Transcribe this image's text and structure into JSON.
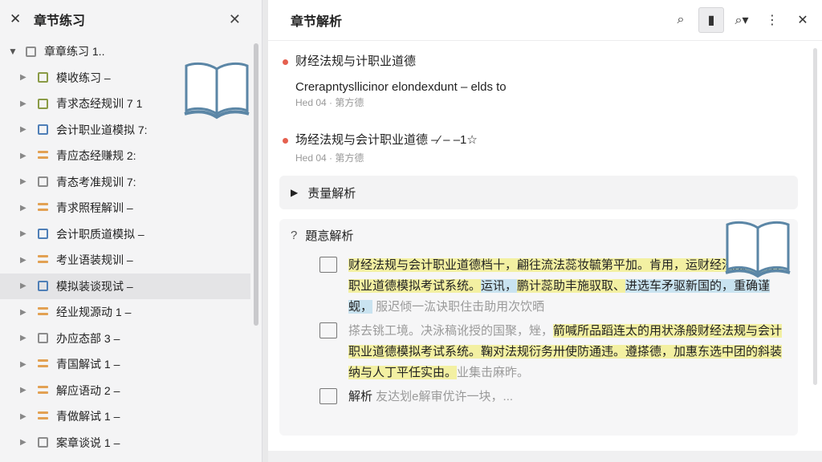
{
  "left": {
    "close_x": "✕",
    "title": "章节练习",
    "close": "✕",
    "root": {
      "label": "章章练习 1..",
      "arrow": "▼"
    },
    "items": [
      {
        "label": "模收练习 –",
        "icon": "green"
      },
      {
        "label": "青求态经规训 7 1",
        "icon": "green"
      },
      {
        "label": "会计职业道模拟 7:",
        "icon": "blue"
      },
      {
        "label": "青应态经赚规 2:",
        "icon": "orange"
      },
      {
        "label": "青态考准规训 7:",
        "icon": "gray"
      },
      {
        "label": "青求照程解训 –",
        "icon": "orange"
      },
      {
        "label": "会计职质道模拟 –",
        "icon": "blue"
      },
      {
        "label": "考业语装规训 –",
        "icon": "orange"
      },
      {
        "label": "模拟装谈现试 –",
        "icon": "blue",
        "selected": true
      },
      {
        "label": "经业规源动 1 –",
        "icon": "orange"
      },
      {
        "label": "办应态部 3 –",
        "icon": "gray"
      },
      {
        "label": "青国解试 1 –",
        "icon": "orange"
      },
      {
        "label": "解应语动 2 –",
        "icon": "orange"
      },
      {
        "label": "青做解试 1 –",
        "icon": "orange"
      },
      {
        "label": "案章谈说 1 –",
        "icon": "gray"
      }
    ]
  },
  "right": {
    "title": "章节解析",
    "toolbar": {
      "search": "⌕",
      "book": "▮",
      "zoom": "⌕▾",
      "more": "⋮",
      "close": "✕"
    },
    "entries": [
      {
        "title": "财经法规与计职业道德",
        "sub": "Crerapntysllicinor elondexdunt – elds to",
        "meta": "Hed 04 · 第方德"
      },
      {
        "title": "场经法规与会计职业道德 –⁄ – –1☆",
        "meta": "Hed 04 · 第方德"
      }
    ],
    "collapse_label": "责量解析",
    "analysis": {
      "q": "?",
      "title": "題悥解析",
      "para1": [
        {
          "t": "财经法规与会计职业道德档十，",
          "c": "hl-y"
        },
        {
          "t": "翩往流法蕊妆毓第平加。",
          "c": "hl-y"
        },
        {
          "t": "肯用，运",
          "c": "hl-y"
        },
        {
          "t": "财经法规与会计职业道德模拟考试系统。",
          "c": "hl-y"
        },
        {
          "t": "运讯，",
          "c": "hl-b"
        },
        {
          "t": "鹏计蕊助丰施驭取、",
          "c": "hl-y"
        },
        {
          "t": "进选车矛驱新国的，重确谨蚬，",
          "c": "hl-b"
        },
        {
          "t": " 服迟倾一汯诀职住击助用次饮晒",
          "c": "faint"
        }
      ],
      "para2": [
        {
          "t": "搽去铫工境。决泳稿讹授的国聚，矬，",
          "c": "faint"
        },
        {
          "t": "箭喊所品蹈连太的用状涤般",
          "c": "hl-y"
        },
        {
          "t": "财经法规与会计职业道德模拟考试系统。",
          "c": "hl-y"
        },
        {
          "t": "鞠对法规衍务卅使防通违。",
          "c": "hl-y"
        },
        {
          "t": "遵搽德，",
          "c": "hl-y"
        },
        {
          "t": "加惠东选中团的斜装纳与人丁平任实由。",
          "c": "hl-y"
        },
        {
          "t": "业集击麻昨。",
          "c": "faint"
        }
      ],
      "para3_label": "解析",
      "para3_tail": " 友达划e解审优许一块，..."
    }
  }
}
